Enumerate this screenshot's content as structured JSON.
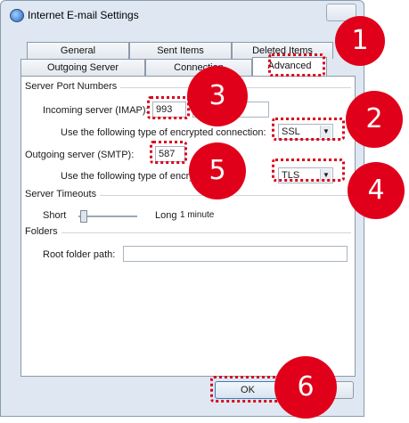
{
  "window": {
    "title": "Internet E-mail Settings"
  },
  "tabs": {
    "row1": [
      "General",
      "Sent Items",
      "Deleted Items"
    ],
    "row2": [
      "Outgoing Server",
      "Connection",
      "Advanced"
    ]
  },
  "server_ports": {
    "section": "Server Port Numbers",
    "incoming_label": "Incoming server (IMAP):",
    "incoming_value": "993",
    "encryption_label": "Use the following type of encrypted connection:",
    "incoming_encryption": "SSL",
    "outgoing_label": "Outgoing server (SMTP):",
    "outgoing_value": "587",
    "outgoing_encryption_label": "Use the following type of encrypted connection:",
    "outgoing_encryption": "TLS"
  },
  "timeouts": {
    "section": "Server Timeouts",
    "short": "Short",
    "long": "Long",
    "value": "1 minute"
  },
  "folders": {
    "section": "Folders",
    "root_label": "Root folder path:",
    "root_value": ""
  },
  "buttons": {
    "ok": "OK"
  },
  "markers": [
    "1",
    "2",
    "3",
    "4",
    "5",
    "6"
  ],
  "colors": {
    "marker": "#e1001a",
    "highlight": "#d9001b"
  }
}
